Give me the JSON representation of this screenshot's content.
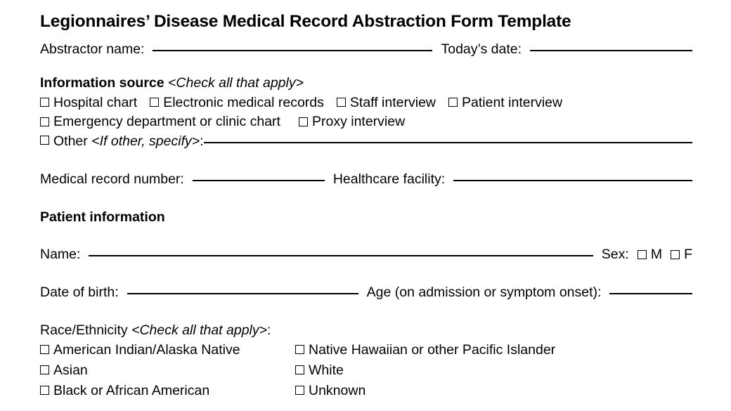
{
  "document": {
    "title": "Legionnaires’ Disease Medical Record Abstraction Form Template"
  },
  "header_fields": {
    "abstractor_name_label": "Abstractor name:",
    "todays_date_label": "Today’s date:"
  },
  "information_source": {
    "heading": "Information source",
    "instruction": "<Check all that apply>",
    "row1": [
      {
        "label": "Hospital chart"
      },
      {
        "label": "Electronic medical records"
      },
      {
        "label": "Staff interview"
      },
      {
        "label": "Patient interview"
      }
    ],
    "row2": [
      {
        "label": "Emergency department or clinic chart"
      },
      {
        "label": "Proxy interview"
      }
    ],
    "other": {
      "label": "Other",
      "instruction": "<If other, specify>",
      "colon": ":"
    }
  },
  "record_fields": {
    "medical_record_number_label": "Medical record number:",
    "healthcare_facility_label": "Healthcare facility:"
  },
  "patient_information": {
    "heading": "Patient information",
    "name_label": "Name:",
    "sex_label": "Sex:",
    "sex_options": [
      {
        "label": "M"
      },
      {
        "label": "F"
      }
    ],
    "date_of_birth_label": "Date of birth:",
    "age_label": "Age (on admission or symptom onset):"
  },
  "race_ethnicity": {
    "heading": "Race/Ethnicity",
    "instruction": "<Check all that apply>",
    "colon": ":",
    "left_options": [
      {
        "label": "American Indian/Alaska Native"
      },
      {
        "label": "Asian"
      },
      {
        "label": "Black or African American"
      }
    ],
    "right_options": [
      {
        "label": "Native Hawaiian or other Pacific Islander"
      },
      {
        "label": "White"
      },
      {
        "label": "Unknown"
      }
    ]
  },
  "colors": {
    "text": "#000000",
    "background": "#ffffff"
  }
}
